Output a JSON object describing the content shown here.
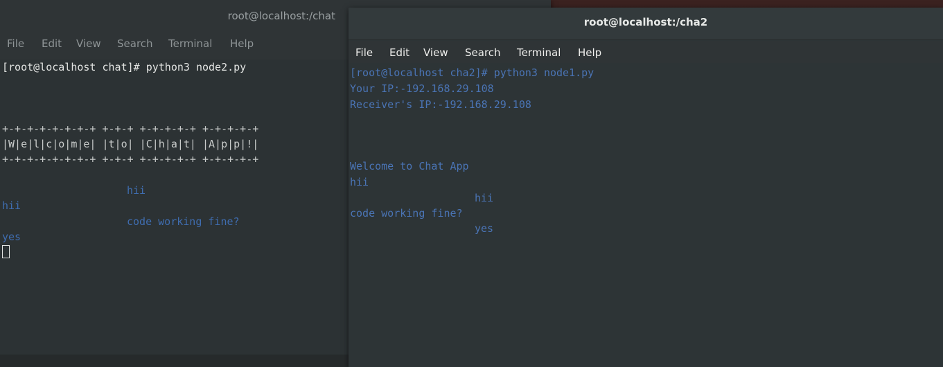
{
  "left_window": {
    "title": "root@localhost:/chat",
    "menu": [
      "File",
      "Edit",
      "View",
      "Search",
      "Terminal",
      "Help"
    ],
    "lines": [
      "[root@localhost chat]# python3 node2.py",
      "+-+-+-+-+-+-+-+ +-+-+ +-+-+-+-+ +-+-+-+-+",
      "|W|e|l|c|o|m|e| |t|o| |C|h|a|t| |A|p|p|!|",
      "+-+-+-+-+-+-+-+ +-+-+ +-+-+-+-+ +-+-+-+-+",
      "hii",
      "hii",
      "code working fine?",
      "yes"
    ]
  },
  "right_window": {
    "title": "root@localhost:/cha2",
    "menu": [
      "File",
      "Edit",
      "View",
      "Search",
      "Terminal",
      "Help"
    ],
    "lines": [
      "[root@localhost cha2]# python3 node1.py",
      "Your IP:-192.168.29.108",
      "Receiver's IP:-192.168.29.108",
      "Welcome to Chat App",
      "hii",
      "hii",
      "code working fine?",
      "yes"
    ]
  }
}
